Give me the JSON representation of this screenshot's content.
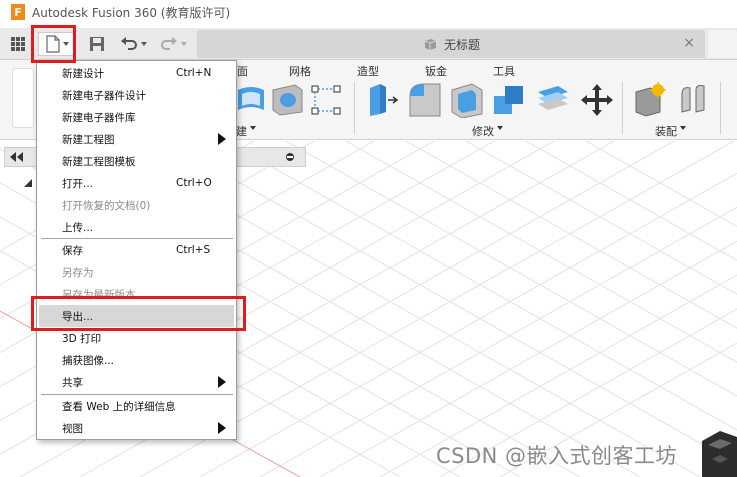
{
  "title_bar": {
    "app_logo_letter": "F",
    "title": "Autodesk Fusion 360 (教育版许可)"
  },
  "toolbar": {
    "grid_icon": "app-grid-icon",
    "file_icon": "file-icon",
    "save_icon": "save-icon",
    "undo_icon": "undo-icon",
    "redo_icon": "redo-icon",
    "document_tab": "无标题",
    "tab_close": "×"
  },
  "ribbon": {
    "tabs": [
      "面",
      "网格",
      "造型",
      "钣金",
      "工具"
    ],
    "groups": [
      "建",
      "修改",
      "装配"
    ]
  },
  "browser": {
    "collapse_icon": "double-left-icon",
    "visibility_icon": "dot-icon"
  },
  "file_menu": {
    "items": [
      {
        "label": "新建设计",
        "shortcut": "Ctrl+N"
      },
      {
        "label": "新建电子器件设计"
      },
      {
        "label": "新建电子器件库"
      },
      {
        "label": "新建工程图"
      },
      {
        "label": "新建工程图模板"
      },
      {
        "label": "打开...",
        "shortcut": "Ctrl+O"
      },
      {
        "label": "打开恢复的文档(0)"
      },
      {
        "label": "上传..."
      },
      {
        "label": "保存",
        "shortcut": "Ctrl+S"
      },
      {
        "label": "另存为"
      },
      {
        "label": "另存为最新版本"
      },
      {
        "label": "导出..."
      },
      {
        "label": "3D 打印"
      },
      {
        "label": "捕获图像..."
      },
      {
        "label": "共享"
      },
      {
        "label": "查看 Web 上的详细信息"
      },
      {
        "label": "视图"
      }
    ]
  },
  "highlight_color": "#e01b1b",
  "watermark": "CSDN @嵌入式创客工坊"
}
